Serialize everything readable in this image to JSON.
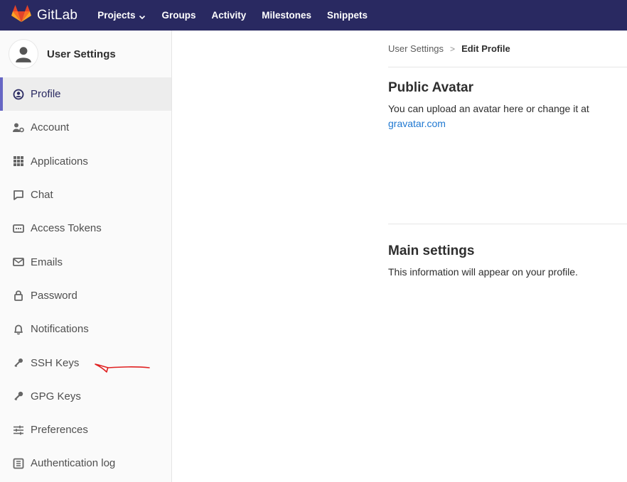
{
  "navbar": {
    "brand": "GitLab",
    "links": [
      {
        "label": "Projects",
        "has_dropdown": true
      },
      {
        "label": "Groups"
      },
      {
        "label": "Activity"
      },
      {
        "label": "Milestones"
      },
      {
        "label": "Snippets"
      }
    ]
  },
  "sidebar": {
    "title": "User Settings",
    "items": [
      {
        "label": "Profile",
        "icon": "profile-icon",
        "active": true
      },
      {
        "label": "Account",
        "icon": "account-icon"
      },
      {
        "label": "Applications",
        "icon": "applications-icon"
      },
      {
        "label": "Chat",
        "icon": "chat-icon"
      },
      {
        "label": "Access Tokens",
        "icon": "token-icon"
      },
      {
        "label": "Emails",
        "icon": "mail-icon"
      },
      {
        "label": "Password",
        "icon": "lock-icon"
      },
      {
        "label": "Notifications",
        "icon": "bell-icon"
      },
      {
        "label": "SSH Keys",
        "icon": "key-icon"
      },
      {
        "label": "GPG Keys",
        "icon": "key-icon"
      },
      {
        "label": "Preferences",
        "icon": "preferences-icon"
      },
      {
        "label": "Authentication log",
        "icon": "log-icon"
      }
    ]
  },
  "breadcrumb": {
    "parent": "User Settings",
    "separator": ">",
    "current": "Edit Profile"
  },
  "avatar_section": {
    "title": "Public Avatar",
    "text": "You can upload an avatar here or change it at",
    "link": "gravatar.com"
  },
  "main_section": {
    "title": "Main settings",
    "text": "This information will appear on your profile."
  },
  "colors": {
    "navbar": "#292961",
    "active_border": "#6666c4",
    "link": "#1f78d1",
    "annotation": "#e02020"
  }
}
